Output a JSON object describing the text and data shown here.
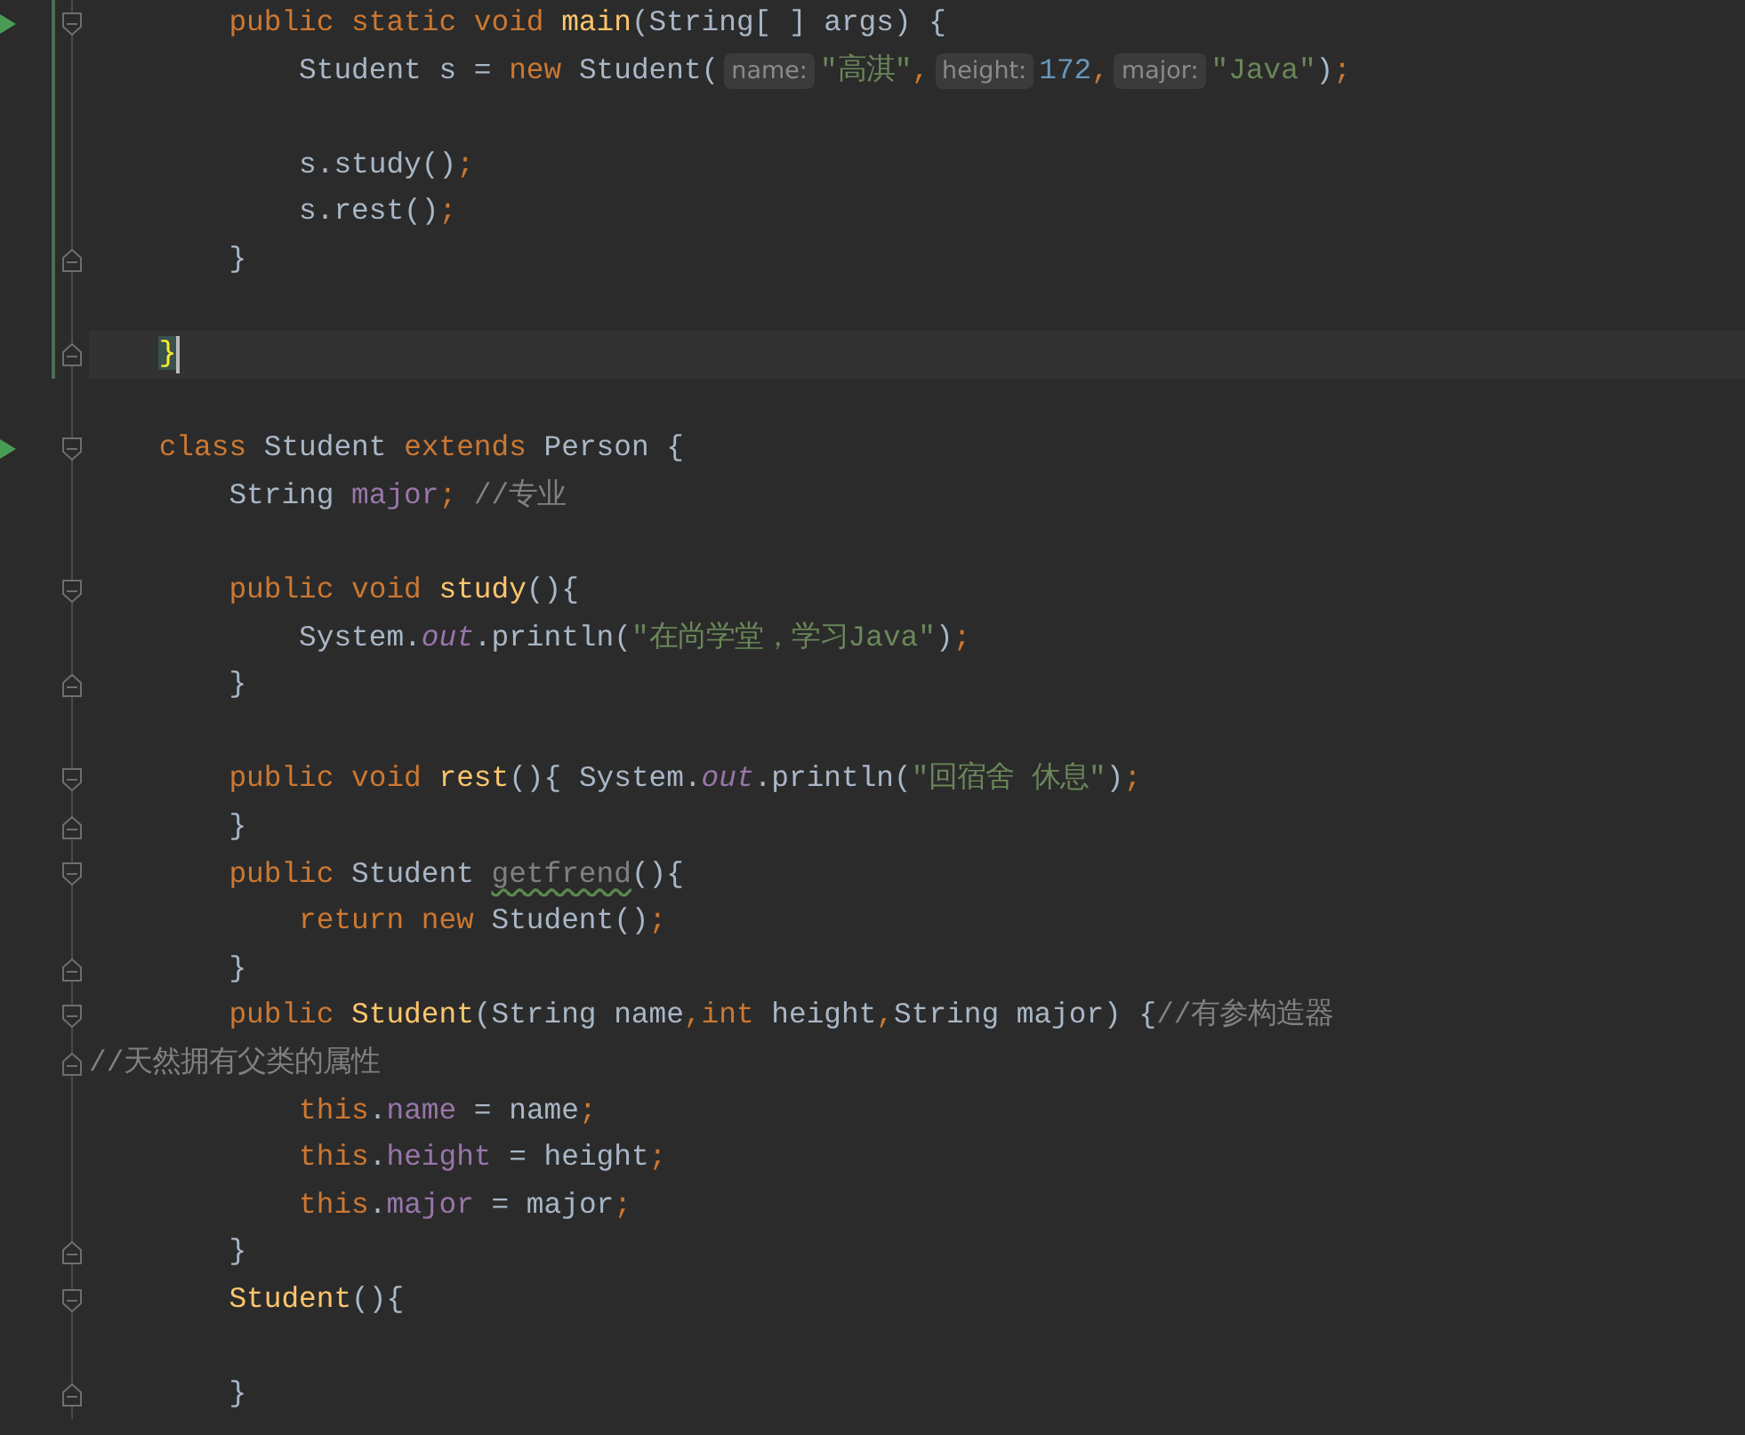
{
  "editor": {
    "lines": [
      {
        "run": true,
        "changed": true,
        "current": false,
        "fold_start": true,
        "fold_end": false,
        "segments": [
          {
            "kind": "code",
            "tokens": [
              {
                "kind": "keyword",
                "text": "        public static void "
              },
              {
                "kind": "method",
                "text": "main"
              },
              {
                "kind": "plain",
                "text": "(String[ ] args) {"
              }
            ]
          }
        ]
      },
      {
        "run": false,
        "changed": true,
        "current": false,
        "fold_start": false,
        "fold_end": false,
        "segments": [
          {
            "kind": "code",
            "tokens": [
              {
                "kind": "plain",
                "text": "            Student s = "
              },
              {
                "kind": "keyword",
                "text": "new "
              },
              {
                "kind": "plain",
                "text": "Student("
              }
            ]
          },
          {
            "kind": "hint",
            "text": "name:"
          },
          {
            "kind": "code",
            "tokens": [
              {
                "kind": "string",
                "text": "\"高淇\""
              },
              {
                "kind": "keyword",
                "text": ","
              }
            ]
          },
          {
            "kind": "hint",
            "text": "height:"
          },
          {
            "kind": "code",
            "tokens": [
              {
                "kind": "number",
                "text": "172"
              },
              {
                "kind": "keyword",
                "text": ","
              }
            ]
          },
          {
            "kind": "hint",
            "text": "major:"
          },
          {
            "kind": "code",
            "tokens": [
              {
                "kind": "string",
                "text": "\"Java\""
              },
              {
                "kind": "plain",
                "text": ")"
              },
              {
                "kind": "keyword",
                "text": ";"
              }
            ]
          }
        ]
      },
      {
        "run": false,
        "changed": true,
        "current": false,
        "fold_start": false,
        "fold_end": false
      },
      {
        "run": false,
        "changed": true,
        "current": false,
        "fold_start": false,
        "fold_end": false,
        "segments": [
          {
            "kind": "code",
            "tokens": [
              {
                "kind": "plain",
                "text": "            s.study()"
              },
              {
                "kind": "keyword",
                "text": ";"
              }
            ]
          }
        ]
      },
      {
        "run": false,
        "changed": true,
        "current": false,
        "fold_start": false,
        "fold_end": false,
        "segments": [
          {
            "kind": "code",
            "tokens": [
              {
                "kind": "plain",
                "text": "            s.rest()"
              },
              {
                "kind": "keyword",
                "text": ";"
              }
            ]
          }
        ]
      },
      {
        "run": false,
        "changed": true,
        "current": false,
        "fold_start": false,
        "fold_end": true,
        "segments": [
          {
            "kind": "code",
            "tokens": [
              {
                "kind": "plain",
                "text": "        }"
              }
            ]
          }
        ]
      },
      {
        "run": false,
        "changed": true,
        "current": false,
        "fold_start": false,
        "fold_end": false
      },
      {
        "run": false,
        "changed": true,
        "current": true,
        "fold_start": false,
        "fold_end": true,
        "segments": [
          {
            "kind": "code",
            "tokens": [
              {
                "kind": "brace-match",
                "text": "    }"
              }
            ]
          }
        ]
      },
      {
        "run": false,
        "changed": false,
        "current": false,
        "fold_start": false,
        "fold_end": false
      },
      {
        "run": true,
        "changed": false,
        "current": false,
        "fold_start": true,
        "fold_end": false,
        "segments": [
          {
            "kind": "code",
            "tokens": [
              {
                "kind": "keyword",
                "text": "    class "
              },
              {
                "kind": "plain",
                "text": "Student "
              },
              {
                "kind": "keyword",
                "text": "extends "
              },
              {
                "kind": "plain",
                "text": "Person {"
              }
            ]
          }
        ]
      },
      {
        "run": false,
        "changed": false,
        "current": false,
        "fold_start": false,
        "fold_end": false,
        "segments": [
          {
            "kind": "code",
            "tokens": [
              {
                "kind": "plain",
                "text": "        String "
              },
              {
                "kind": "field",
                "text": "major"
              },
              {
                "kind": "keyword",
                "text": ";"
              },
              {
                "kind": "comment",
                "text": " //专业"
              }
            ]
          }
        ]
      },
      {
        "run": false,
        "changed": false,
        "current": false,
        "fold_start": false,
        "fold_end": false
      },
      {
        "run": false,
        "changed": false,
        "current": false,
        "fold_start": true,
        "fold_end": false,
        "segments": [
          {
            "kind": "code",
            "tokens": [
              {
                "kind": "keyword",
                "text": "        public void "
              },
              {
                "kind": "method",
                "text": "study"
              },
              {
                "kind": "plain",
                "text": "(){"
              }
            ]
          }
        ]
      },
      {
        "run": false,
        "changed": false,
        "current": false,
        "fold_start": false,
        "fold_end": false,
        "segments": [
          {
            "kind": "code",
            "tokens": [
              {
                "kind": "plain",
                "text": "            System."
              },
              {
                "kind": "static",
                "text": "out"
              },
              {
                "kind": "plain",
                "text": ".println("
              },
              {
                "kind": "string",
                "text": "\"在尚学堂，学习Java\""
              },
              {
                "kind": "plain",
                "text": ")"
              },
              {
                "kind": "keyword",
                "text": ";"
              }
            ]
          }
        ]
      },
      {
        "run": false,
        "changed": false,
        "current": false,
        "fold_start": false,
        "fold_end": true,
        "segments": [
          {
            "kind": "code",
            "tokens": [
              {
                "kind": "plain",
                "text": "        }"
              }
            ]
          }
        ]
      },
      {
        "run": false,
        "changed": false,
        "current": false,
        "fold_start": false,
        "fold_end": false
      },
      {
        "run": false,
        "changed": false,
        "current": false,
        "fold_start": true,
        "fold_end": false,
        "segments": [
          {
            "kind": "code",
            "tokens": [
              {
                "kind": "keyword",
                "text": "        public void "
              },
              {
                "kind": "method",
                "text": "rest"
              },
              {
                "kind": "plain",
                "text": "(){ System."
              },
              {
                "kind": "static",
                "text": "out"
              },
              {
                "kind": "plain",
                "text": ".println("
              },
              {
                "kind": "string",
                "text": "\"回宿舍 休息\""
              },
              {
                "kind": "plain",
                "text": ")"
              },
              {
                "kind": "keyword",
                "text": ";"
              }
            ]
          }
        ]
      },
      {
        "run": false,
        "changed": false,
        "current": false,
        "fold_start": false,
        "fold_end": true,
        "segments": [
          {
            "kind": "code",
            "tokens": [
              {
                "kind": "plain",
                "text": "        }"
              }
            ]
          }
        ]
      },
      {
        "run": false,
        "changed": false,
        "current": false,
        "fold_start": true,
        "fold_end": false,
        "segments": [
          {
            "kind": "code",
            "tokens": [
              {
                "kind": "keyword",
                "text": "        public "
              },
              {
                "kind": "plain",
                "text": "Student "
              },
              {
                "kind": "unused",
                "text": "getfrend"
              },
              {
                "kind": "plain",
                "text": "(){"
              }
            ]
          }
        ]
      },
      {
        "run": false,
        "changed": false,
        "current": false,
        "fold_start": false,
        "fold_end": false,
        "segments": [
          {
            "kind": "code",
            "tokens": [
              {
                "kind": "keyword",
                "text": "            return new "
              },
              {
                "kind": "plain",
                "text": "Student()"
              },
              {
                "kind": "keyword",
                "text": ";"
              }
            ]
          }
        ]
      },
      {
        "run": false,
        "changed": false,
        "current": false,
        "fold_start": false,
        "fold_end": true,
        "segments": [
          {
            "kind": "code",
            "tokens": [
              {
                "kind": "plain",
                "text": "        }"
              }
            ]
          }
        ]
      },
      {
        "run": false,
        "changed": false,
        "current": false,
        "fold_start": true,
        "fold_end": false,
        "segments": [
          {
            "kind": "code",
            "tokens": [
              {
                "kind": "keyword",
                "text": "        public "
              },
              {
                "kind": "method",
                "text": "Student"
              },
              {
                "kind": "plain",
                "text": "(String name"
              },
              {
                "kind": "keyword",
                "text": ",int "
              },
              {
                "kind": "plain",
                "text": "height"
              },
              {
                "kind": "keyword",
                "text": ","
              },
              {
                "kind": "plain",
                "text": "String major) {"
              },
              {
                "kind": "comment",
                "text": "//有参构造器"
              }
            ]
          }
        ]
      },
      {
        "run": false,
        "changed": false,
        "current": false,
        "fold_start": false,
        "fold_end": true,
        "segments": [
          {
            "kind": "code",
            "tokens": [
              {
                "kind": "comment",
                "text": "//天然拥有父类的属性"
              }
            ]
          }
        ]
      },
      {
        "run": false,
        "changed": false,
        "current": false,
        "fold_start": false,
        "fold_end": false,
        "segments": [
          {
            "kind": "code",
            "tokens": [
              {
                "kind": "keyword",
                "text": "            this"
              },
              {
                "kind": "plain",
                "text": "."
              },
              {
                "kind": "field",
                "text": "name"
              },
              {
                "kind": "plain",
                "text": " = name"
              },
              {
                "kind": "keyword",
                "text": ";"
              }
            ]
          }
        ]
      },
      {
        "run": false,
        "changed": false,
        "current": false,
        "fold_start": false,
        "fold_end": false,
        "segments": [
          {
            "kind": "code",
            "tokens": [
              {
                "kind": "keyword",
                "text": "            this"
              },
              {
                "kind": "plain",
                "text": "."
              },
              {
                "kind": "field",
                "text": "height"
              },
              {
                "kind": "plain",
                "text": " = height"
              },
              {
                "kind": "keyword",
                "text": ";"
              }
            ]
          }
        ]
      },
      {
        "run": false,
        "changed": false,
        "current": false,
        "fold_start": false,
        "fold_end": false,
        "segments": [
          {
            "kind": "code",
            "tokens": [
              {
                "kind": "keyword",
                "text": "            this"
              },
              {
                "kind": "plain",
                "text": "."
              },
              {
                "kind": "field",
                "text": "major"
              },
              {
                "kind": "plain",
                "text": " = major"
              },
              {
                "kind": "keyword",
                "text": ";"
              }
            ]
          }
        ]
      },
      {
        "run": false,
        "changed": false,
        "current": false,
        "fold_start": false,
        "fold_end": true,
        "segments": [
          {
            "kind": "code",
            "tokens": [
              {
                "kind": "plain",
                "text": "        }"
              }
            ]
          }
        ]
      },
      {
        "run": false,
        "changed": false,
        "current": false,
        "fold_start": true,
        "fold_end": false,
        "segments": [
          {
            "kind": "code",
            "tokens": [
              {
                "kind": "method",
                "text": "        Student"
              },
              {
                "kind": "plain",
                "text": "(){"
              }
            ]
          }
        ]
      },
      {
        "run": false,
        "changed": false,
        "current": false,
        "fold_start": false,
        "fold_end": false
      },
      {
        "run": false,
        "changed": false,
        "current": false,
        "fold_start": false,
        "fold_end": true,
        "segments": [
          {
            "kind": "code",
            "tokens": [
              {
                "kind": "plain",
                "text": "        }"
              }
            ]
          }
        ]
      }
    ]
  }
}
